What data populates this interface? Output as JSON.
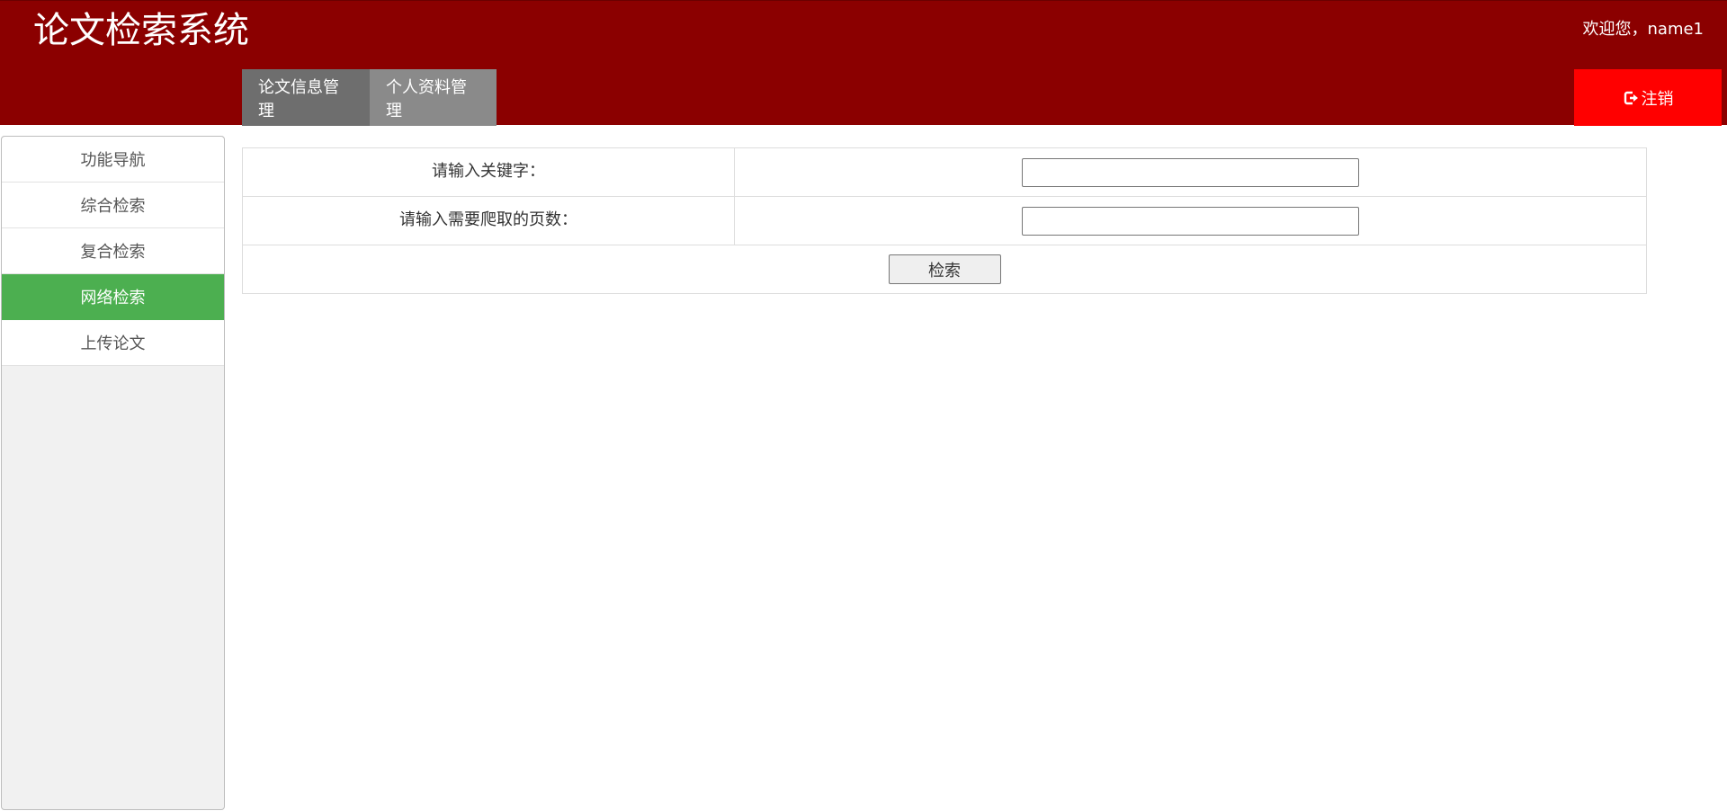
{
  "header": {
    "title": "论文检索系统",
    "welcome": "欢迎您，name1",
    "logout_label": "注销",
    "tabs": [
      {
        "label": "论文信息管理"
      },
      {
        "label": "个人资料管理"
      }
    ]
  },
  "sidebar": {
    "items": [
      {
        "label": "功能导航"
      },
      {
        "label": "综合检索"
      },
      {
        "label": "复合检索"
      },
      {
        "label": "网络检索"
      },
      {
        "label": "上传论文"
      }
    ],
    "active_item": "网络检索"
  },
  "form": {
    "keyword_label": "请输入关键字：",
    "keyword_value": "",
    "pages_label": "请输入需要爬取的页数：",
    "pages_value": "",
    "search_button": "检索"
  },
  "colors": {
    "header_bg": "#8b0000",
    "logout_bg": "#ff0000",
    "active_item_bg": "#4caf50"
  },
  "icons": {
    "logout": "sign-out-icon"
  }
}
